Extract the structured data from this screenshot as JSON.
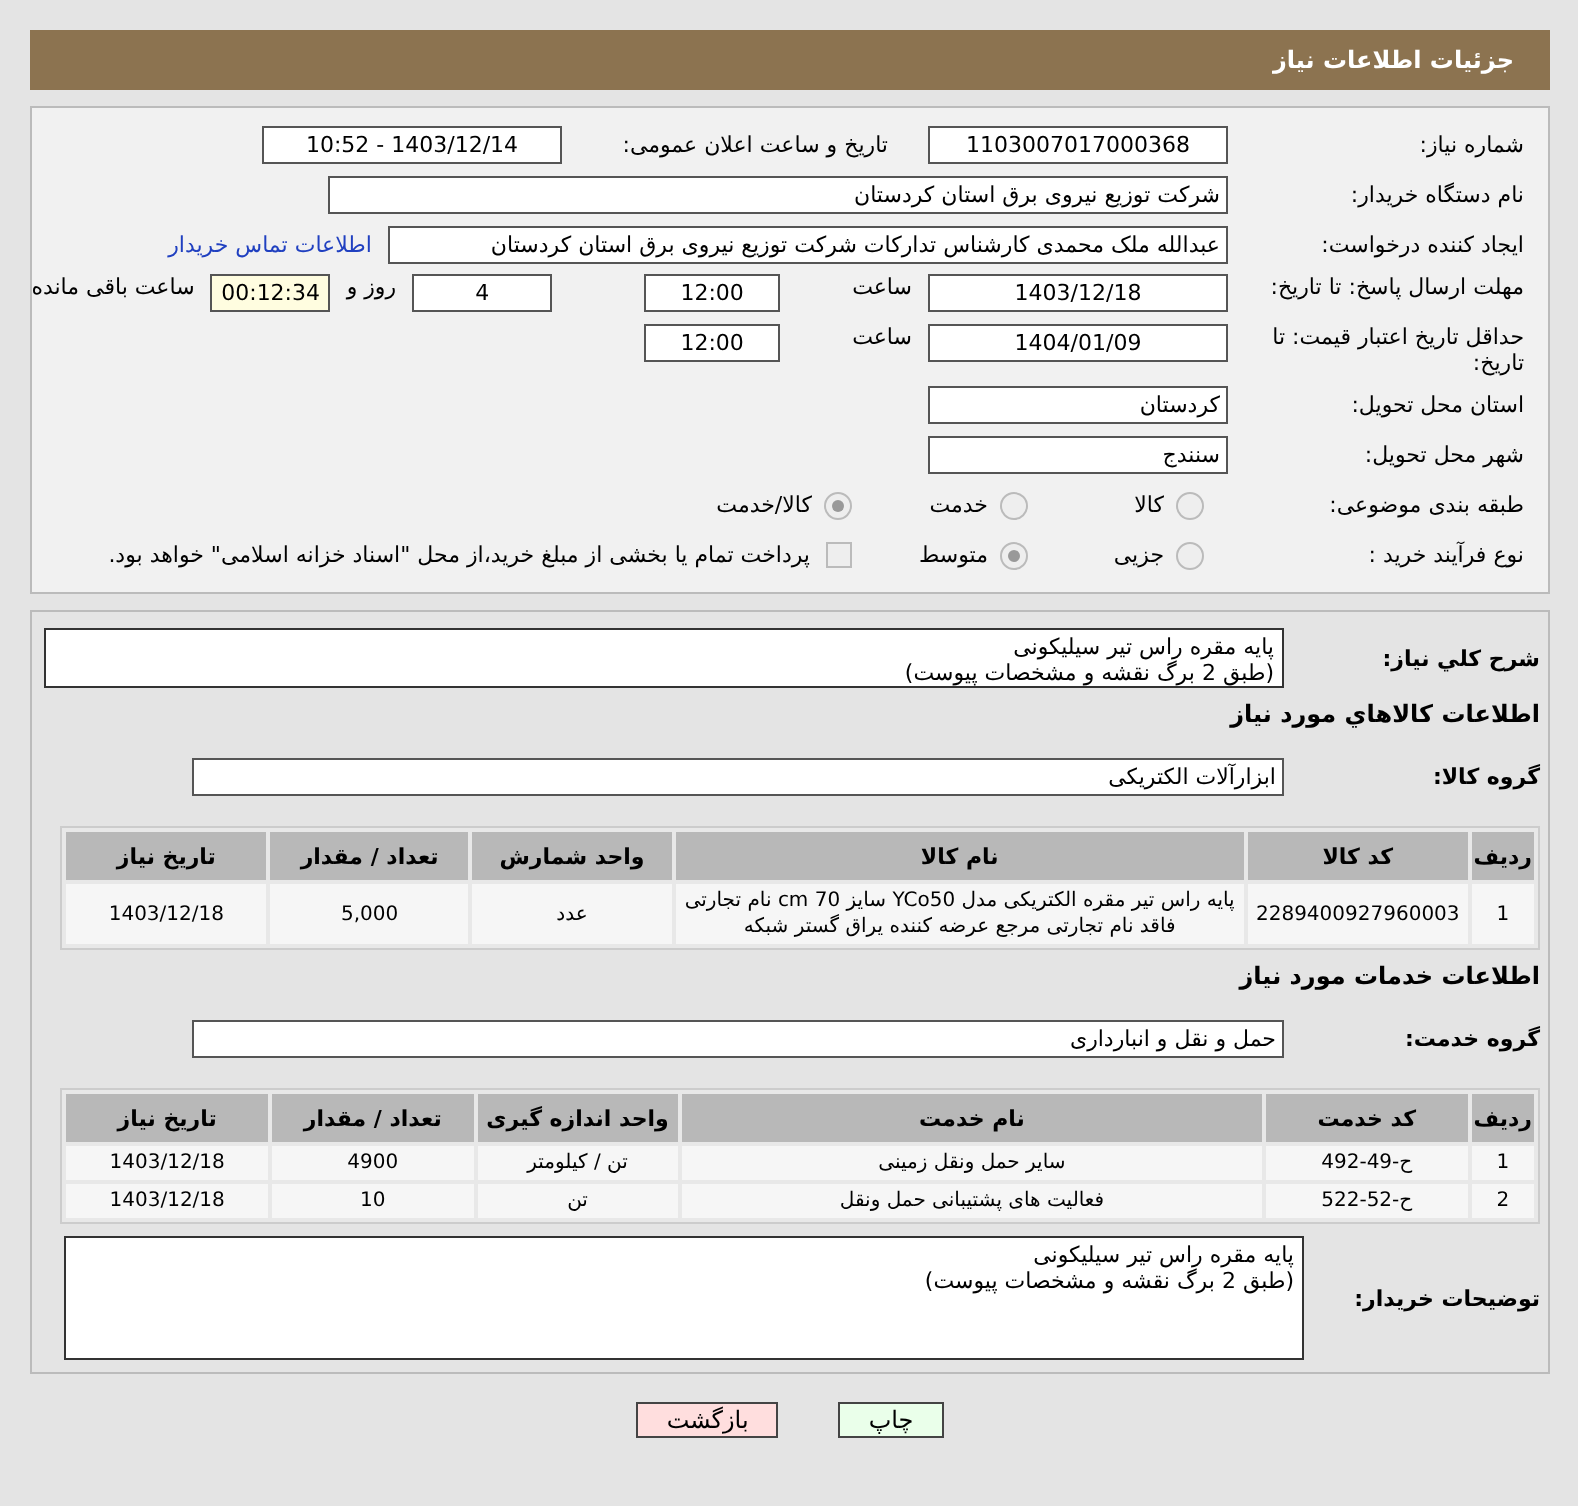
{
  "header": {
    "title": "جزئیات اطلاعات نیاز"
  },
  "need_number": {
    "label": "شماره نیاز:",
    "value": "1103007017000368"
  },
  "announce": {
    "label": "تاریخ و ساعت اعلان عمومی:",
    "value": "1403/12/14 - 10:52"
  },
  "buyer": {
    "label": "نام دستگاه خریدار:",
    "value": "شرکت توزیع نیروی برق استان کردستان"
  },
  "requester": {
    "label": "ایجاد کننده درخواست:",
    "value": "عبدالله ملک محمدی کارشناس تدارکات شرکت توزیع نیروی برق استان کردستان",
    "link": "اطلاعات تماس خریدار"
  },
  "deadline": {
    "label": "مهلت ارسال پاسخ: تا تاریخ:",
    "date": "1403/12/18",
    "time_label": "ساعت",
    "time": "12:00",
    "days": "4",
    "days_label": "روز و",
    "remaining": "00:12:34",
    "remaining_label": "ساعت باقی مانده"
  },
  "validity": {
    "label": "حداقل تاریخ اعتبار قیمت: تا تاریخ:",
    "date": "1404/01/09",
    "time_label": "ساعت",
    "time": "12:00"
  },
  "province": {
    "label": "استان محل تحویل:",
    "value": "کردستان"
  },
  "city": {
    "label": "شهر محل تحویل:",
    "value": "سنندج"
  },
  "category": {
    "label": "طبقه بندی موضوعی:",
    "options": [
      {
        "label": "کالا",
        "selected": false
      },
      {
        "label": "خدمت",
        "selected": false
      },
      {
        "label": "کالا/خدمت",
        "selected": true
      }
    ]
  },
  "process": {
    "label": "نوع فرآیند خرید :",
    "options": [
      {
        "label": "جزیی",
        "selected": false
      },
      {
        "label": "متوسط",
        "selected": true
      }
    ],
    "payment_checked": false,
    "payment_text": "پرداخت تمام یا بخشی از مبلغ خرید،از محل \"اسناد خزانه اسلامی\" خواهد بود."
  },
  "summary": {
    "label": "شرح کلي نياز:",
    "lines": [
      "پایه مقره راس تیر سیلیکونی",
      "(طبق 2 برگ نقشه و مشخصات پیوست)"
    ]
  },
  "goods": {
    "title": "اطلاعات کالاهاي مورد نياز",
    "group_label": "گروه کالا:",
    "group": "ابزارآلات الکتریکی",
    "columns": [
      "ردیف",
      "کد کالا",
      "نام کالا",
      "واحد شمارش",
      "تعداد / مقدار",
      "تاریخ نیاز"
    ],
    "rows": [
      [
        "1",
        "2289400927960003",
        "پایه راس تیر مقره الکتریکی مدل YCo50 سایز cm 70 نام تجارتی فاقد نام تجارتی مرجع عرضه کننده یراق گستر شبکه",
        "عدد",
        "5,000",
        "1403/12/18"
      ]
    ]
  },
  "services": {
    "title": "اطلاعات خدمات مورد نياز",
    "group_label": "گروه خدمت:",
    "group": "حمل و نقل و انبارداری",
    "columns": [
      "ردیف",
      "کد خدمت",
      "نام خدمت",
      "واحد اندازه گیری",
      "تعداد / مقدار",
      "تاریخ نیاز"
    ],
    "rows": [
      [
        "1",
        "ح-49-492",
        "سایر حمل ونقل زمینی",
        "تن / کیلومتر",
        "4900",
        "1403/12/18"
      ],
      [
        "2",
        "ح-52-522",
        "فعالیت های پشتیبانی حمل ونقل",
        "تن",
        "10",
        "1403/12/18"
      ]
    ]
  },
  "buyer_notes": {
    "label": "توضیحات خریدار:",
    "lines": [
      "پایه مقره راس تیر سیلیکونی",
      "(طبق 2 برگ نقشه و مشخصات پیوست)"
    ]
  },
  "buttons": [
    {
      "label": "چاپ",
      "kind": "print"
    },
    {
      "label": "بازگشت",
      "kind": "back"
    }
  ]
}
